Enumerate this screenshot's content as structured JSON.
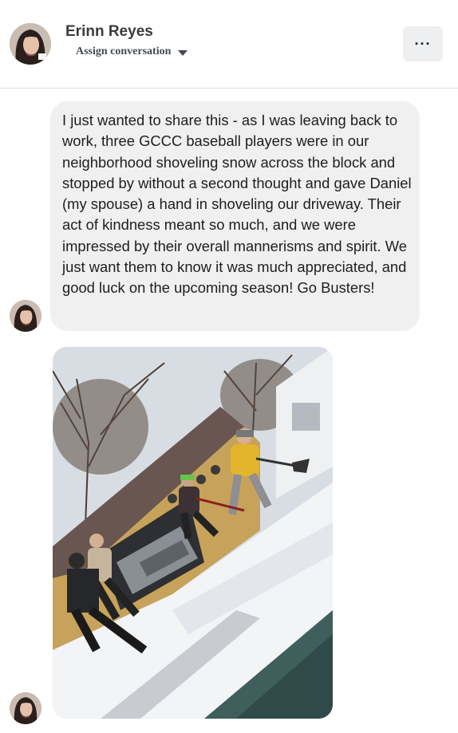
{
  "header": {
    "contact_name": "Erinn Reyes",
    "assign_label": "Assign conversation",
    "more_label": "···"
  },
  "message": {
    "text": "I just wanted to share this -  as I was leaving back to work, three GCCC baseball players were in our neighborhood shoveling snow across the block and stopped by without a second thought and gave Daniel (my spouse) a hand in shoveling our driveway. Their act of kindness meant so much, and we were impressed by their overall mannerisms and spirit. We just want them to know it was much appreciated, and good luck on the upcoming season! Go Busters!"
  },
  "colors": {
    "bubble": "#f0f0f0",
    "text": "#1c1e21",
    "divider": "#dadde1"
  }
}
